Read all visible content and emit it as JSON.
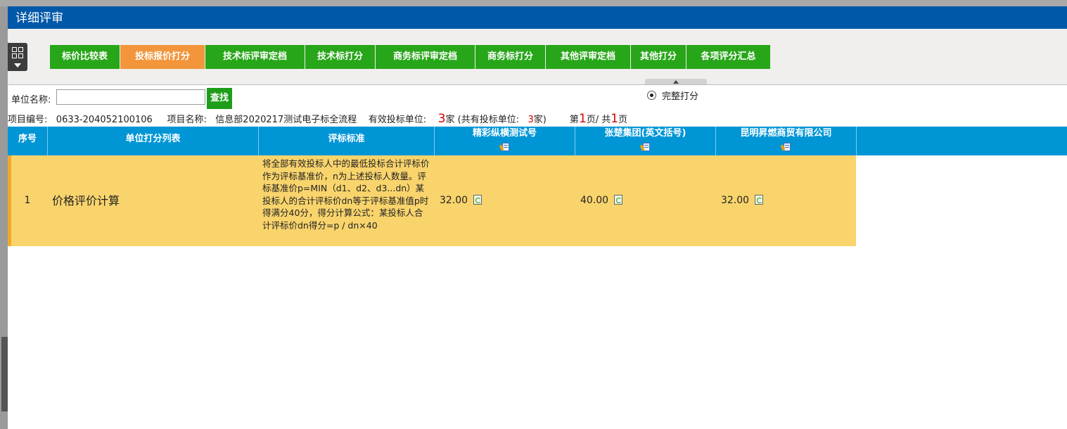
{
  "window": {
    "title": "详细评审"
  },
  "toolbar": {
    "tabs": [
      {
        "label": "标价比较表",
        "active": false
      },
      {
        "label": "投标报价打分",
        "active": true
      },
      {
        "label": "技术标评审定档",
        "active": false
      },
      {
        "label": "技术标打分",
        "active": false
      },
      {
        "label": "商务标评审定档",
        "active": false
      },
      {
        "label": "商务标打分",
        "active": false
      },
      {
        "label": "其他评审定档",
        "active": false
      },
      {
        "label": "其他打分",
        "active": false
      },
      {
        "label": "各项评分汇总",
        "active": false
      }
    ]
  },
  "search": {
    "label": "单位名称:",
    "value": "",
    "button": "查找"
  },
  "scoring_mode": {
    "label": "完整打分",
    "selected": true
  },
  "project": {
    "code_label": "项目编号:",
    "code": "0633-204052100106",
    "name_label": "项目名称:",
    "name": "信息部2020217测试电子标全流程",
    "valid_label": "有效投标单位:",
    "valid_count": "3",
    "valid_unit": "家",
    "total_prefix": "(共有投标单位:",
    "total_count": "3",
    "total_suffix": "家)",
    "page_prefix": "第",
    "page_current": "1",
    "page_mid": "页/ 共",
    "page_total": "1",
    "page_suffix": "页"
  },
  "table": {
    "headers": {
      "seq": "序号",
      "item": "单位打分列表",
      "criteria": "评标标准",
      "bidders": [
        "精彩纵横测试号",
        "张楚集团(英文括号)",
        "昆明昇燃商贸有限公司"
      ]
    },
    "rows": [
      {
        "seq": "1",
        "item": "价格评价计算",
        "criteria": "将全部有效投标人中的最低投标合计评标价作为评标基准价，n为上述投标人数量。评标基准价p=MIN（d1、d2、d3...dn）某投标人的合计评标价dn等于评标基准值p时得满分40分，得分计算公式：某投标人合计评标价dn得分=p / dn×40",
        "scores": [
          "32.00",
          "40.00",
          "32.00"
        ]
      }
    ]
  },
  "colors": {
    "header_bg": "#0058a8",
    "tab_bg": "#28a619",
    "tab_active_bg": "#f2953b",
    "table_header_bg": "#0096d6",
    "row_highlight": "#f9d46c",
    "count_red": "#d40000"
  },
  "icons": {
    "menu": "grid-menu-icon",
    "collapse": "caret-up-icon",
    "bidder_header": "document-edit-icon",
    "score_action": "refresh-icon"
  }
}
